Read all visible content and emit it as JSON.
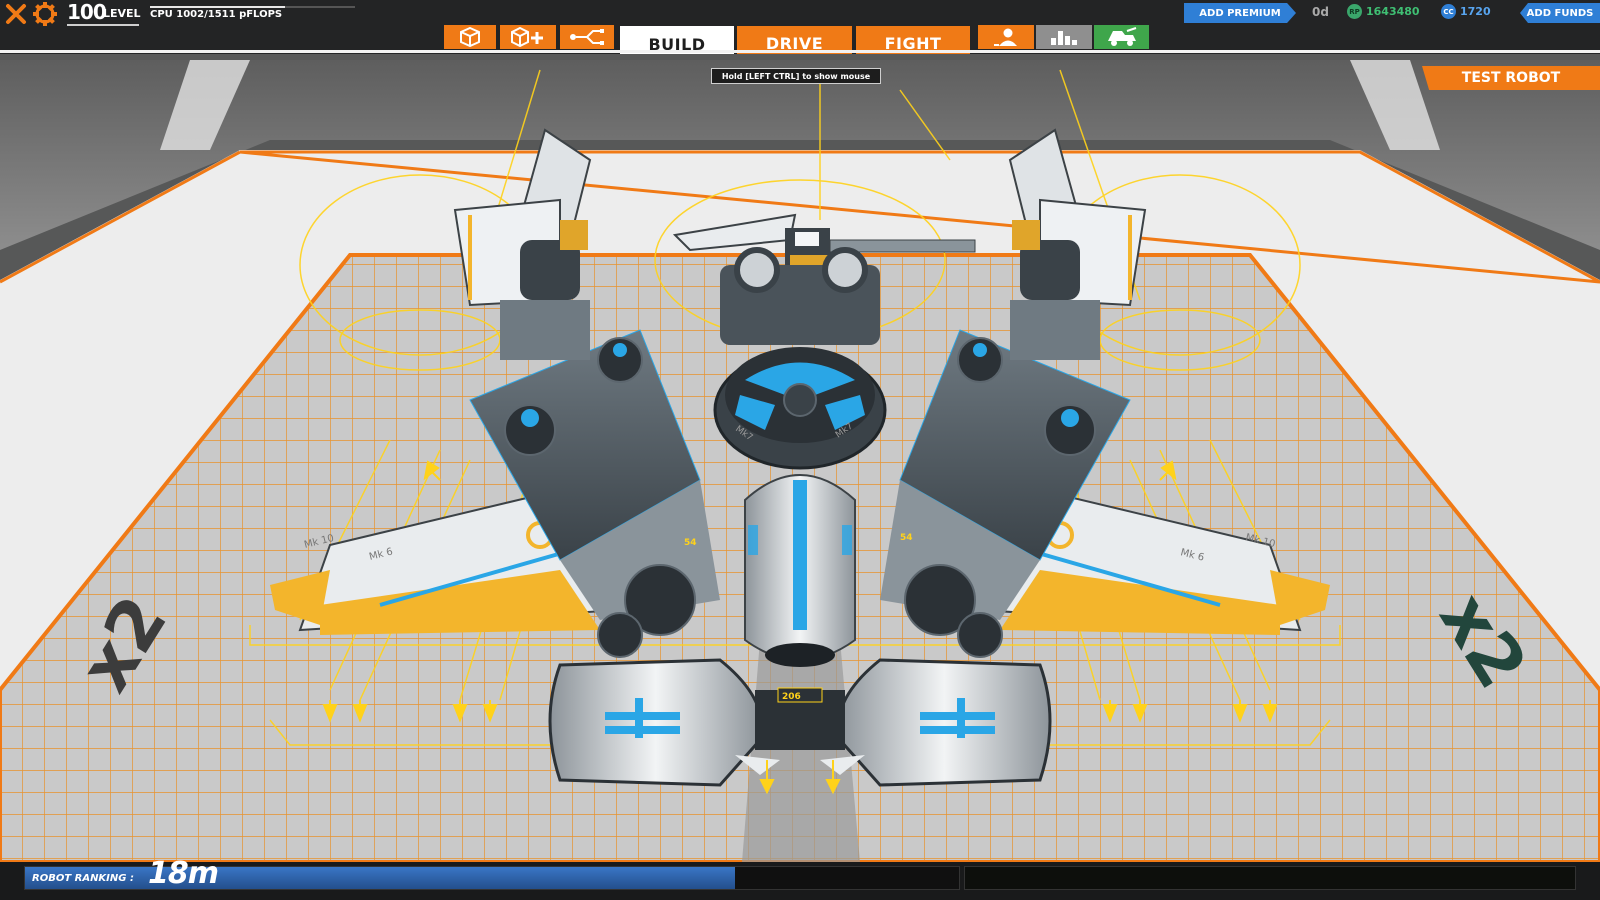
{
  "topbar": {
    "level_number": "100",
    "level_label": "LEVEL",
    "cpu_text": "CPU 1002/1511 pFLOPS",
    "cpu_fraction": 0.66,
    "tools": [
      {
        "icon": "cube-icon"
      },
      {
        "icon": "cube-add-icon"
      },
      {
        "icon": "connector-icon"
      }
    ],
    "modes": [
      {
        "label": "BUILD",
        "active": true
      },
      {
        "label": "DRIVE",
        "active": false
      },
      {
        "label": "FIGHT",
        "active": false
      }
    ],
    "right_buttons": [
      {
        "icon": "person-icon",
        "color": "#f07a16"
      },
      {
        "icon": "bar-stats-icon",
        "color": "#8f8f8f"
      },
      {
        "icon": "robot-shop-icon",
        "color": "#3fa64b"
      }
    ],
    "add_premium_label": "ADD PREMIUM",
    "premium_days": "0d",
    "rp_icon_text": "RP",
    "rp_amount": "1643480",
    "cc_icon_text": "CC",
    "cc_amount": "1720",
    "add_funds_label": "ADD FUNDS"
  },
  "tooltip": "Hold [LEFT CTRL] to show mouse",
  "test_robot_label": "TEST ROBOT",
  "scene": {
    "floor_markings": [
      "x2",
      "x2"
    ],
    "part_labels": [
      "Mk 10",
      "Mk 6",
      "Mk 6",
      "Mk 10",
      "Mk7",
      "Mk7"
    ],
    "readouts": [
      "206",
      "54",
      "54"
    ]
  },
  "bottombar": {
    "ranking_label": "ROBOT RANKING :",
    "ranking_value": "18m",
    "ranking_fraction": 0.76
  },
  "colors": {
    "accent_orange": "#f07a16",
    "premium_blue": "#2f7fd6",
    "rp_green": "#3fbf73",
    "guide_yellow": "#ffd21a",
    "robot_blue": "#2aa6e6"
  }
}
